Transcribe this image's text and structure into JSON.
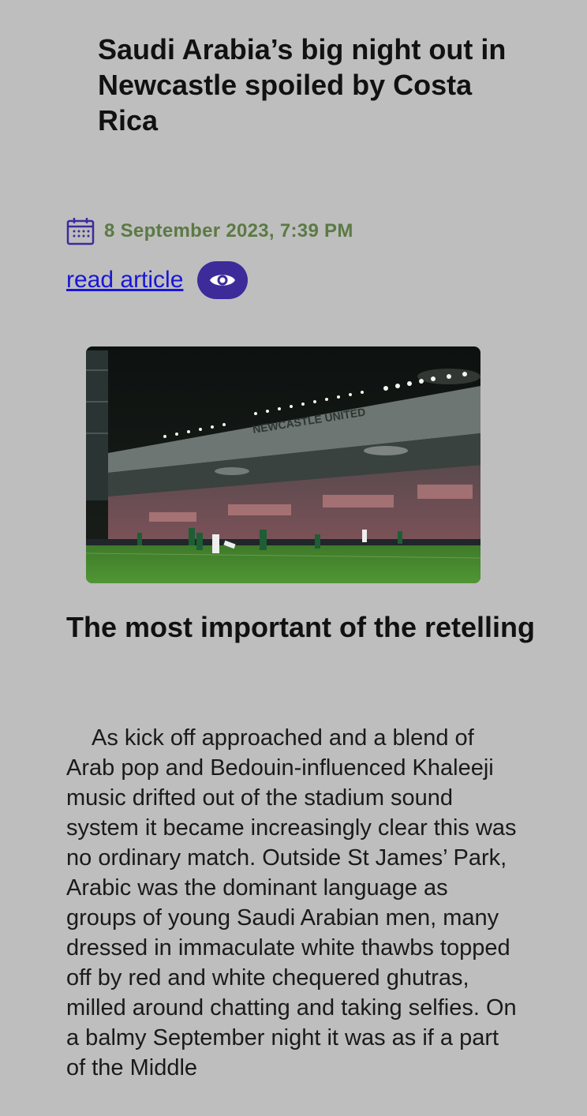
{
  "article": {
    "title": "Saudi Arabia’s big night out in Newcastle spoiled by Costa Rica",
    "date": "8 September 2023, 7:39 PM",
    "read_link_label": "read article",
    "view_button_icon": "eye-icon",
    "date_icon": "calendar-icon",
    "hero_image": {
      "stadium_sign": "NEWCASTLE UNITED"
    },
    "section_heading": "The most important of the retelling",
    "body": "As kick off approached and a blend of Arab pop and Bedouin-influenced Khaleeji music drifted out of the stadium sound system it became increasingly clear this was no ordinary match. Outside St James’ Park, Arabic was the dominant language as groups of young Saudi Arabian men, many dressed in immaculate white thawbs topped off by red and white chequered ghutras, milled around chatting and taking selfies. On a balmy September night it was as if a part of the Middle"
  },
  "colors": {
    "background": "#bebebe",
    "date_text": "#5b7a44",
    "link": "#1a16d6",
    "view_button": "#3d2b9a",
    "calendar_icon": "#3d2b9a"
  }
}
